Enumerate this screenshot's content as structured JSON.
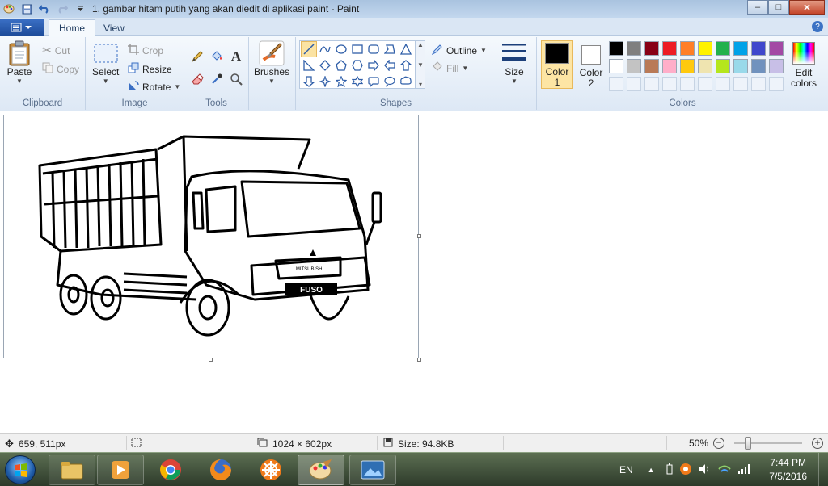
{
  "window": {
    "title": "1. gambar hitam putih yang akan diedit di aplikasi paint - Paint",
    "minimize": "–",
    "maximize": "□",
    "close": "✕"
  },
  "tabs": [
    {
      "label": "Home",
      "active": true
    },
    {
      "label": "View",
      "active": false
    }
  ],
  "help_label": "?",
  "clipboard": {
    "group_label": "Clipboard",
    "paste": "Paste",
    "cut": "Cut",
    "copy": "Copy"
  },
  "image": {
    "group_label": "Image",
    "select": "Select",
    "crop": "Crop",
    "resize": "Resize",
    "rotate": "Rotate"
  },
  "tools": {
    "group_label": "Tools",
    "text_tool_glyph": "A"
  },
  "brushes": {
    "label": "Brushes"
  },
  "shapes": {
    "group_label": "Shapes",
    "outline": "Outline",
    "fill": "Fill"
  },
  "size": {
    "label": "Size"
  },
  "colors": {
    "group_label": "Colors",
    "color1_line1": "Color",
    "color1_line2": "1",
    "color2_line1": "Color",
    "color2_line2": "2",
    "color1_value": "#000000",
    "color2_value": "#ffffff",
    "edit_line1": "Edit",
    "edit_line2": "colors",
    "palette_row1": [
      "#000000",
      "#7f7f7f",
      "#880015",
      "#ed1c24",
      "#ff7f27",
      "#fff200",
      "#22b14c",
      "#00a2e8",
      "#3f48cc",
      "#a349a4"
    ],
    "palette_row2": [
      "#ffffff",
      "#c3c3c3",
      "#b97a57",
      "#ffaec9",
      "#ffc90e",
      "#efe4b0",
      "#b5e61d",
      "#99d9ea",
      "#7092be",
      "#c8bfe7"
    ],
    "palette_row3_count": 10
  },
  "status": {
    "cursor_pos": "659, 511px",
    "dimensions": "1024 × 602px",
    "file_size": "Size: 94.8KB",
    "zoom": "50%",
    "zoom_level": 0.2
  },
  "canvas_image": {
    "logo": "FUSO",
    "grille_text": "MITSUBISHI"
  },
  "taskbar": {
    "language": "EN",
    "time": "7:44 PM",
    "date": "7/5/2016"
  }
}
